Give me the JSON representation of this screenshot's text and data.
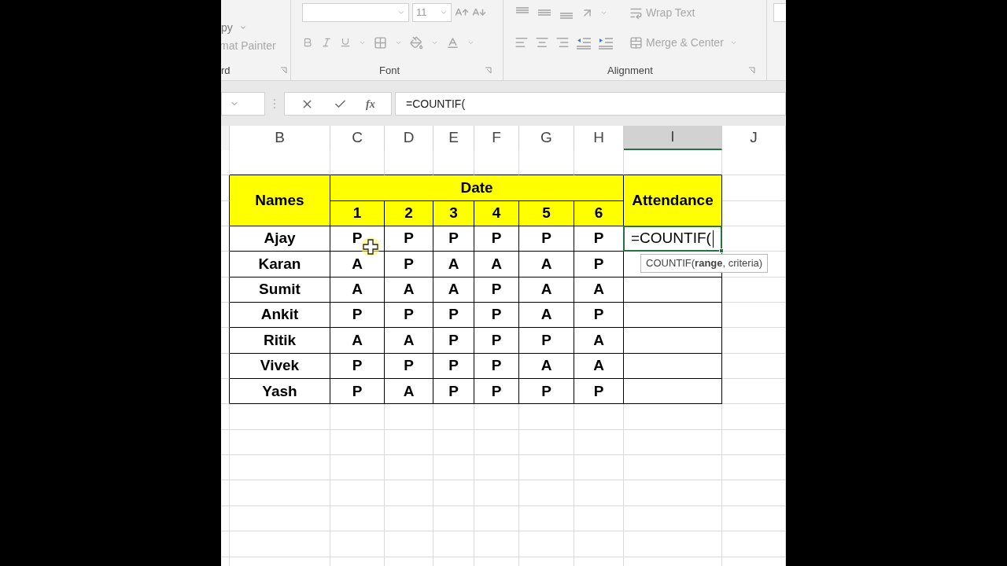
{
  "ribbon": {
    "clipboard": {
      "items": [
        "py",
        "mat Painter"
      ],
      "label": "rd"
    },
    "font": {
      "size": "11",
      "label": "Font"
    },
    "alignment": {
      "wrap_text": "Wrap Text",
      "merge_center": "Merge & Center",
      "label": "Alignment"
    }
  },
  "formula_bar": {
    "fx": "fx",
    "formula": "=COUNTIF("
  },
  "columns": [
    {
      "label": "B",
      "selected": false
    },
    {
      "label": "C",
      "selected": false
    },
    {
      "label": "D",
      "selected": false
    },
    {
      "label": "E",
      "selected": false
    },
    {
      "label": "F",
      "selected": false
    },
    {
      "label": "G",
      "selected": false
    },
    {
      "label": "H",
      "selected": false
    },
    {
      "label": "I",
      "selected": true
    },
    {
      "label": "J",
      "selected": false
    }
  ],
  "table": {
    "names_header": "Names",
    "date_header": "Date",
    "attendance_header": "Attendance",
    "days": [
      "1",
      "2",
      "3",
      "4",
      "5",
      "6"
    ],
    "rows": [
      {
        "name": "Ajay",
        "marks": [
          "P",
          "P",
          "P",
          "P",
          "P",
          "P"
        ],
        "attendance": "=COUNTIF(",
        "editing": true
      },
      {
        "name": "Karan",
        "marks": [
          "A",
          "P",
          "A",
          "A",
          "A",
          "P"
        ],
        "editing": false
      },
      {
        "name": "Sumit",
        "marks": [
          "A",
          "A",
          "A",
          "P",
          "A",
          "A"
        ],
        "editing": false
      },
      {
        "name": "Ankit",
        "marks": [
          "P",
          "P",
          "P",
          "P",
          "A",
          "P"
        ],
        "editing": false
      },
      {
        "name": "Ritik",
        "marks": [
          "A",
          "A",
          "P",
          "P",
          "P",
          "A"
        ],
        "editing": false
      },
      {
        "name": "Vivek",
        "marks": [
          "P",
          "P",
          "P",
          "P",
          "A",
          "A"
        ],
        "editing": false
      },
      {
        "name": "Yash",
        "marks": [
          "P",
          "A",
          "P",
          "P",
          "P",
          "P"
        ],
        "editing": false
      }
    ]
  },
  "tooltip": "COUNTIF(**range**, criteria)"
}
